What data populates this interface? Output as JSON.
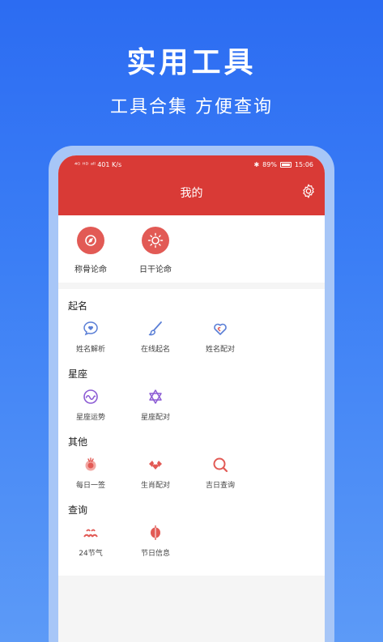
{
  "promo": {
    "title": "实用工具",
    "subtitle": "工具合集  方便查询"
  },
  "statusbar": {
    "left": "⁴ᴳ ᴴᴰ ᵃˡˡ 401 K/s",
    "battery_text": "89%",
    "time": "15:06"
  },
  "appbar": {
    "title": "我的"
  },
  "top_tools": [
    {
      "label": "称骨论命",
      "icon": "compass-icon"
    },
    {
      "label": "日干论命",
      "icon": "sun-icon"
    }
  ],
  "sections": [
    {
      "title": "起名",
      "tools": [
        {
          "label": "姓名解析",
          "icon": "heart-chat-icon"
        },
        {
          "label": "在线起名",
          "icon": "brush-icon"
        },
        {
          "label": "姓名配对",
          "icon": "heart-icon"
        }
      ]
    },
    {
      "title": "星座",
      "tools": [
        {
          "label": "星座运势",
          "icon": "wave-icon"
        },
        {
          "label": "星座配对",
          "icon": "star-of-david-icon"
        }
      ]
    },
    {
      "title": "其他",
      "tools": [
        {
          "label": "每日一签",
          "icon": "lucky-draw-icon"
        },
        {
          "label": "生肖配对",
          "icon": "zodiac-icon"
        },
        {
          "label": "吉日查询",
          "icon": "search-icon"
        }
      ]
    },
    {
      "title": "查询",
      "tools": [
        {
          "label": "24节气",
          "icon": "solar-term-icon"
        },
        {
          "label": "节日信息",
          "icon": "lantern-icon"
        }
      ]
    }
  ],
  "colors": {
    "background": "#3b7ef5",
    "appbar": "#d93a36",
    "accent_red": "#e25a55",
    "accent_blue": "#5b7fd6",
    "accent_purple": "#8c5bd4"
  }
}
